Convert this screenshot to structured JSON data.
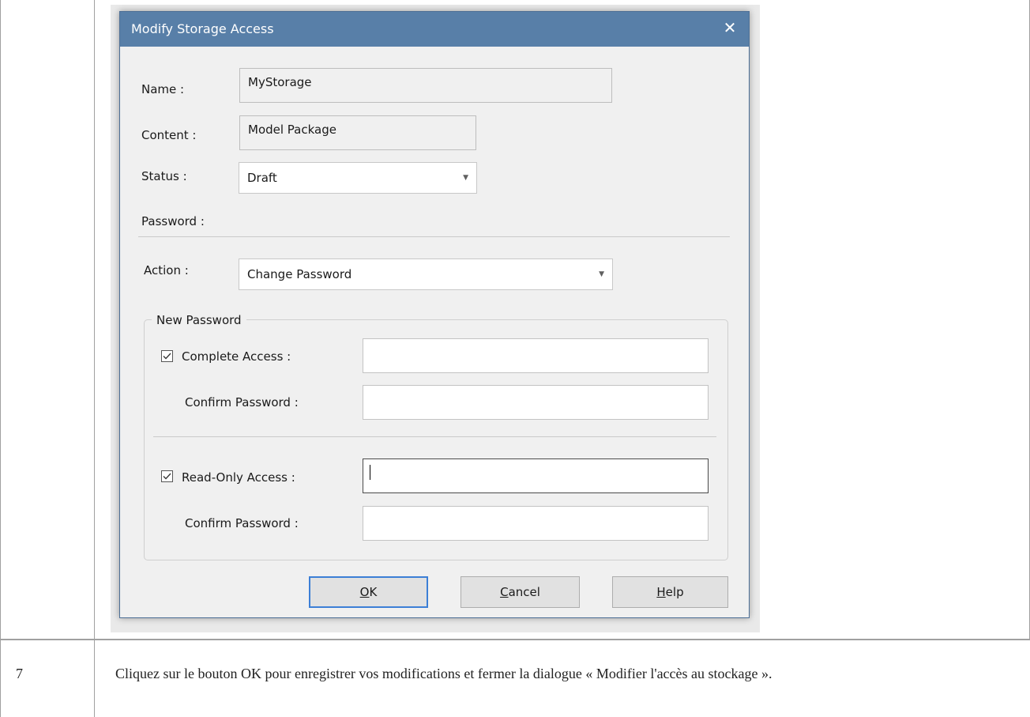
{
  "dialog": {
    "title": "Modify Storage Access",
    "close_glyph": "✕",
    "name_label": "Name :",
    "name_value": "MyStorage",
    "content_label": "Content :",
    "content_value": "Model Package",
    "status_label": "Status :",
    "status_value": "Draft",
    "password_label": "Password :",
    "action_label": "Action :",
    "action_value": "Change Password",
    "group_title": "New Password",
    "complete_access_label": "Complete Access :",
    "complete_access_checked": true,
    "confirm_password_label_1": "Confirm Password :",
    "readonly_access_label": "Read-Only Access :",
    "readonly_access_checked": true,
    "confirm_password_label_2": "Confirm Password :",
    "ok_first": "O",
    "ok_rest": "K",
    "cancel_first": "C",
    "cancel_rest": "ancel",
    "help_first": "H",
    "help_rest": "elp",
    "combo_arrow_icon": "dropdown-arrow-icon"
  },
  "doc": {
    "step_number": "7",
    "step_text": "Cliquez sur le bouton OK pour enregistrer vos modifications et fermer la dialogue « Modifier l'accès au stockage »."
  }
}
